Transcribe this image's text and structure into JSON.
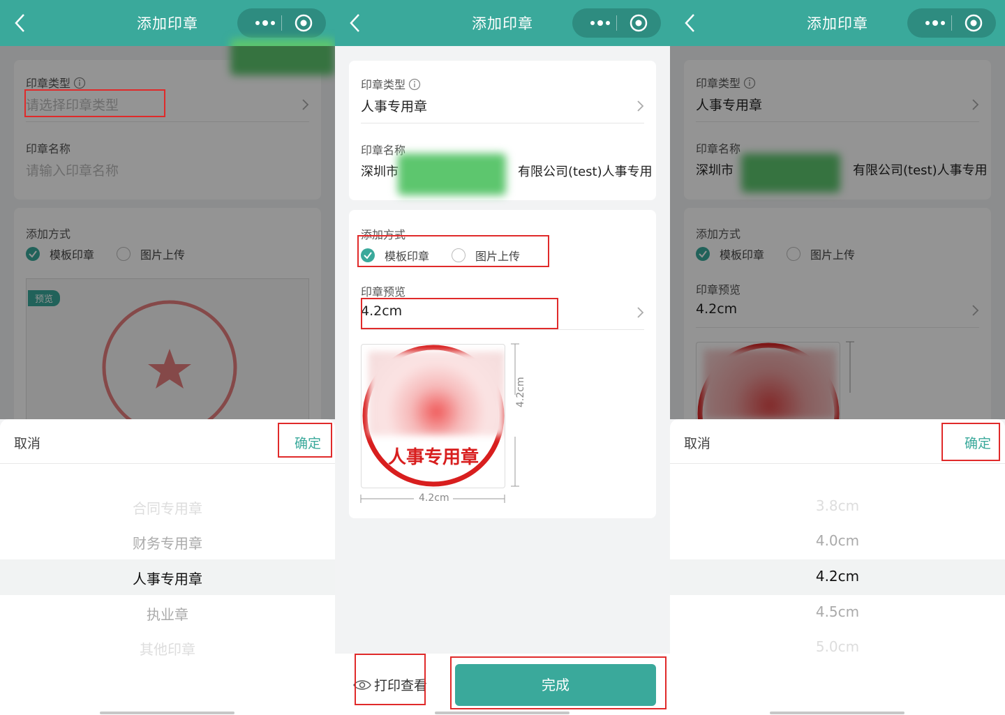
{
  "nav": {
    "title": "添加印章"
  },
  "form": {
    "type_label": "印章类型",
    "type_placeholder": "请选择印章类型",
    "type_value": "人事专用章",
    "name_label": "印章名称",
    "name_placeholder": "请输入印章名称",
    "name_value_prefix": "深圳市",
    "name_value_suffix": "有限公司(test)人事专用",
    "method_label": "添加方式",
    "method_options": [
      "模板印章",
      "图片上传"
    ],
    "method_selected": "模板印章",
    "preview_label": "印章预览",
    "preview_value": "4.2cm",
    "preview_tag": "预览",
    "stamp_text": "人事专用章",
    "stamp_dim": "4.2cm"
  },
  "footer": {
    "print_label": "打印查看",
    "done_label": "完成"
  },
  "sheet": {
    "cancel": "取消",
    "confirm": "确定"
  },
  "type_picker": {
    "items": [
      "合同专用章",
      "财务专用章",
      "人事专用章",
      "执业章",
      "其他印章"
    ],
    "selected_index": 2
  },
  "size_picker": {
    "items": [
      "3.8cm",
      "4.0cm",
      "4.2cm",
      "4.5cm",
      "5.0cm"
    ],
    "selected_index": 2
  },
  "colors": {
    "brand": "#3aa99b",
    "highlight": "#e02a2a",
    "stamp_red": "#d81e1e"
  }
}
